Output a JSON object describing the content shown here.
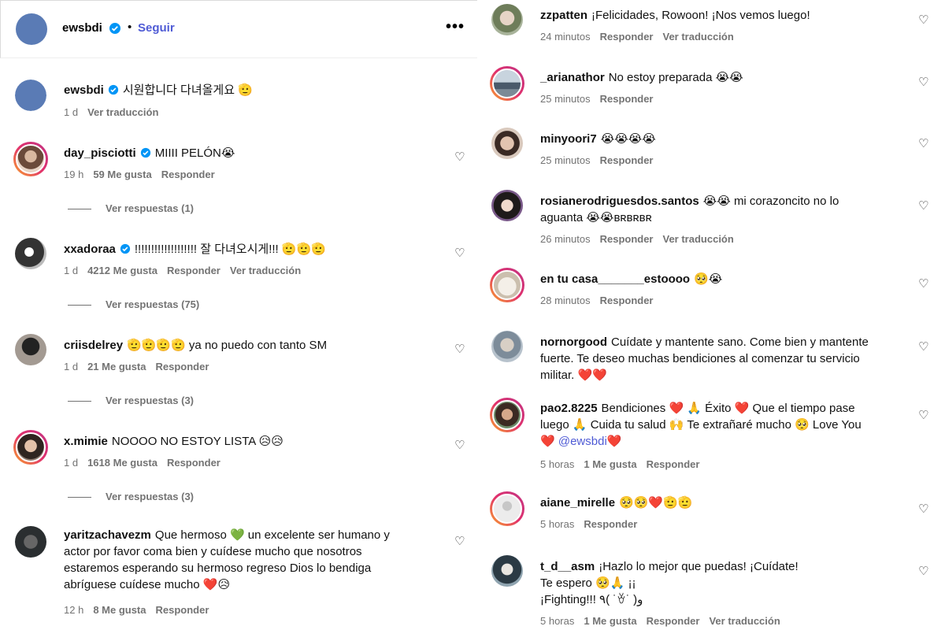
{
  "header": {
    "username": "ewsbdi",
    "dot": "•",
    "follow": "Seguir",
    "more": "•••"
  },
  "caption": {
    "username": "ewsbdi",
    "text": "시원합니다 다녀올게요 🫡",
    "time": "1 d",
    "translate": "Ver traducción"
  },
  "left_comments": [
    {
      "username": "day_pisciotti",
      "text": "MIIII PELÓN😭",
      "time": "19 h",
      "likes": "59 Me gusta",
      "reply": "Responder",
      "replies": "Ver respuestas (1)"
    },
    {
      "username": "xxadoraa",
      "text": "!!!!!!!!!!!!!!!!!!! 잘 다녀오시게!!! 🫡🫡🫡",
      "time": "1 d",
      "likes": "4212 Me gusta",
      "reply": "Responder",
      "translate": "Ver traducción",
      "replies": "Ver respuestas (75)"
    },
    {
      "username": "criisdelrey",
      "text": "🫡🫡🫡🫡 ya no puedo con tanto SM",
      "time": "1 d",
      "likes": "21 Me gusta",
      "reply": "Responder",
      "replies": "Ver respuestas (3)"
    },
    {
      "username": "x.mimie",
      "text": "NOOOO NO ESTOY LISTA 😥😥",
      "time": "1 d",
      "likes": "1618 Me gusta",
      "reply": "Responder",
      "replies": "Ver respuestas (3)"
    },
    {
      "username": "yaritzachavezm",
      "line1": "Que hermoso 💚 un excelente ser humano y",
      "line2": "actor por favor coma bien y cuídese mucho que nosotros",
      "line3": "estaremos esperando su hermoso regreso Dios lo bendiga",
      "line4": "abríguese cuídese mucho ❤️😥",
      "time": "12 h",
      "likes": "8 Me gusta",
      "reply": "Responder"
    }
  ],
  "right_comments": [
    {
      "username": "zzpatten",
      "text": "¡Felicidades, Rowoon! ¡Nos vemos luego!",
      "time": "24 minutos",
      "reply": "Responder",
      "translate": "Ver traducción"
    },
    {
      "username": "_arianathor",
      "text": "No estoy preparada 😭😭",
      "time": "25 minutos",
      "reply": "Responder"
    },
    {
      "username": "minyoori7",
      "text": "😭😭😭😭",
      "time": "25 minutos",
      "reply": "Responder"
    },
    {
      "username": "rosianerodriguesdos.santos",
      "line1": "😭😭 mi corazoncito no lo",
      "line2": "aguanta 😭😭ʙʀʙʀʙʀ",
      "time": "26 minutos",
      "reply": "Responder",
      "translate": "Ver traducción"
    },
    {
      "username": "en tu casa_______estoooo",
      "text": "🥺😭",
      "time": "28 minutos",
      "reply": "Responder"
    },
    {
      "username": "nornorgood",
      "line1": "Cuídate y mantente sano. Come bien y mantente",
      "line2": "fuerte. Te deseo muchas bendiciones al comenzar tu servicio",
      "line3": "militar. ❤️❤️"
    },
    {
      "username": "pao2.8225",
      "line1": "Bendiciones ❤️ 🙏 Éxito ❤️ Que el tiempo pase",
      "line2": "luego 🙏 Cuida tu salud 🙌 Te extrañaré mucho 🥺 Love You",
      "line3_heart": "❤️",
      "mention": "@ewsbdi",
      "line3_end": "❤️",
      "time": "5 horas",
      "likes": "1 Me gusta",
      "reply": "Responder"
    },
    {
      "username": "aiane_mirelle",
      "text": "🥺🥺❤️🫡🫡",
      "time": "5 horas",
      "reply": "Responder"
    },
    {
      "username": "t_d__asm",
      "line1": "¡Hazlo lo mejor que puedas! ¡Cuídate!",
      "line2": "Te espero 🥺🙏 ¡¡",
      "line3": "¡Fighting!!! ٩( ˙ꈊ˙ )و",
      "time": "5 horas",
      "likes": "1 Me gusta",
      "reply": "Responder",
      "translate": "Ver traducción"
    }
  ]
}
